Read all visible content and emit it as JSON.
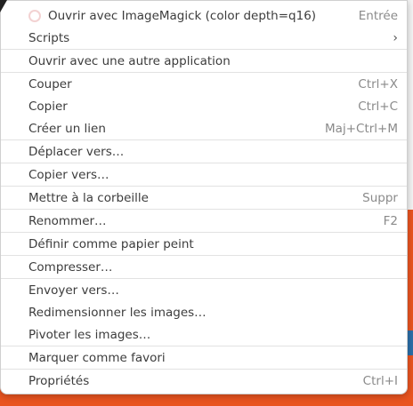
{
  "menu": {
    "open_with_imagemagick": {
      "label": "Ouvrir avec ImageMagick (color depth=q16)",
      "shortcut": "Entrée"
    },
    "scripts": {
      "label": "Scripts",
      "arrow": "›"
    },
    "open_other_app": {
      "label": "Ouvrir avec une autre application"
    },
    "cut": {
      "label": "Couper",
      "shortcut": "Ctrl+X"
    },
    "copy": {
      "label": "Copier",
      "shortcut": "Ctrl+C"
    },
    "create_link": {
      "label": "Créer un lien",
      "shortcut": "Maj+Ctrl+M"
    },
    "move_to": {
      "label": "Déplacer vers…"
    },
    "copy_to": {
      "label": "Copier vers…"
    },
    "trash": {
      "label": "Mettre à la corbeille",
      "shortcut": "Suppr"
    },
    "rename": {
      "label": "Renommer…",
      "shortcut": "F2"
    },
    "set_wallpaper": {
      "label": "Définir comme papier peint"
    },
    "compress": {
      "label": "Compresser…"
    },
    "send_to": {
      "label": "Envoyer vers…"
    },
    "resize_images": {
      "label": "Redimensionner les images…"
    },
    "rotate_images": {
      "label": "Pivoter les images…"
    },
    "star": {
      "label": "Marquer comme favori"
    },
    "properties": {
      "label": "Propriétés",
      "shortcut": "Ctrl+I"
    }
  },
  "colors": {
    "background_accent": "#e95420",
    "menu_background": "#ffffff",
    "shortcut_text": "#8a8a8a"
  }
}
